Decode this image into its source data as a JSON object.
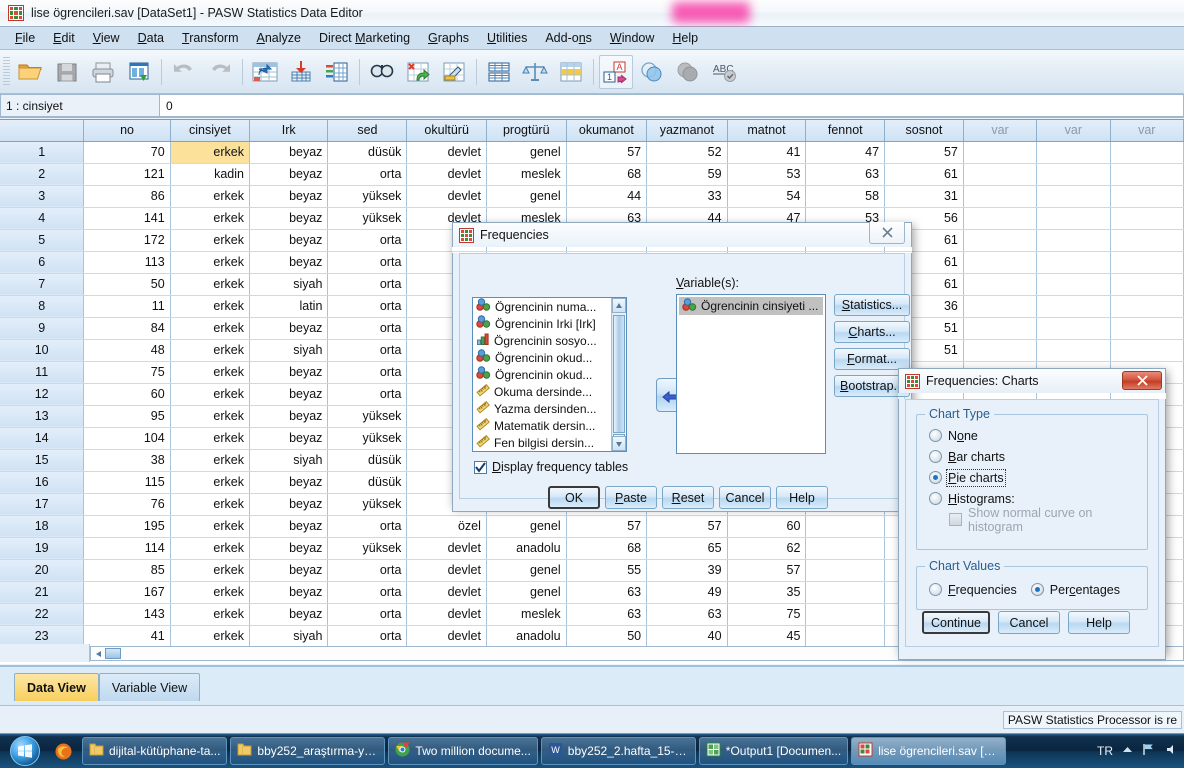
{
  "window": {
    "title": "lise ögrencileri.sav [DataSet1] - PASW Statistics Data Editor",
    "icon": "spss-data-editor-icon"
  },
  "menubar": [
    {
      "label": "File",
      "accel": "F"
    },
    {
      "label": "Edit",
      "accel": "E"
    },
    {
      "label": "View",
      "accel": "V"
    },
    {
      "label": "Data",
      "accel": "D"
    },
    {
      "label": "Transform",
      "accel": "T"
    },
    {
      "label": "Analyze",
      "accel": "A"
    },
    {
      "label": "Direct Marketing",
      "accel": "M"
    },
    {
      "label": "Graphs",
      "accel": "G"
    },
    {
      "label": "Utilities",
      "accel": "U"
    },
    {
      "label": "Add-ons",
      "accel": "n"
    },
    {
      "label": "Window",
      "accel": "W"
    },
    {
      "label": "Help",
      "accel": "H"
    }
  ],
  "toolbar": [
    "open-file-icon",
    "save-icon",
    "print-icon",
    "recall-dialogs-icon",
    "undo-icon",
    "redo-icon",
    "goto-case-icon",
    "goto-variable-icon",
    "variables-icon",
    "find-icon",
    "insert-case-icon",
    "insert-variable-icon",
    "split-file-icon",
    "weight-cases-icon",
    "select-cases-icon",
    "value-labels-icon",
    "use-variable-sets-icon",
    "show-all-variables-icon",
    "spell-check-icon"
  ],
  "cellref": {
    "name": "1 : cinsiyet",
    "value": "0"
  },
  "grid": {
    "columns": [
      "no",
      "cinsiyet",
      "Irk",
      "sed",
      "okultürü",
      "progtürü",
      "okumanot",
      "yazmanot",
      "matnot",
      "fennot",
      "sosnot",
      "var",
      "var",
      "var"
    ],
    "selected_cell": {
      "row": 1,
      "column": "cinsiyet"
    },
    "rows": [
      {
        "n": "1",
        "no": "70",
        "cinsiyet": "erkek",
        "Irk": "beyaz",
        "sed": "düsük",
        "okultürü": "devlet",
        "progtürü": "genel",
        "okumanot": "57",
        "yazmanot": "52",
        "matnot": "41",
        "fennot": "47",
        "sosnot": "57"
      },
      {
        "n": "2",
        "no": "121",
        "cinsiyet": "kadin",
        "Irk": "beyaz",
        "sed": "orta",
        "okultürü": "devlet",
        "progtürü": "meslek",
        "okumanot": "68",
        "yazmanot": "59",
        "matnot": "53",
        "fennot": "63",
        "sosnot": "61"
      },
      {
        "n": "3",
        "no": "86",
        "cinsiyet": "erkek",
        "Irk": "beyaz",
        "sed": "yüksek",
        "okultürü": "devlet",
        "progtürü": "genel",
        "okumanot": "44",
        "yazmanot": "33",
        "matnot": "54",
        "fennot": "58",
        "sosnot": "31"
      },
      {
        "n": "4",
        "no": "141",
        "cinsiyet": "erkek",
        "Irk": "beyaz",
        "sed": "yüksek",
        "okultürü": "devlet",
        "progtürü": "meslek",
        "okumanot": "63",
        "yazmanot": "44",
        "matnot": "47",
        "fennot": "53",
        "sosnot": "56"
      },
      {
        "n": "5",
        "no": "172",
        "cinsiyet": "erkek",
        "Irk": "beyaz",
        "sed": "orta",
        "okultürü": "",
        "progtürü": "",
        "okumanot": "",
        "yazmanot": "",
        "matnot": "",
        "fennot": "",
        "sosnot": "61"
      },
      {
        "n": "6",
        "no": "113",
        "cinsiyet": "erkek",
        "Irk": "beyaz",
        "sed": "orta",
        "okultürü": "",
        "progtürü": "",
        "okumanot": "",
        "yazmanot": "",
        "matnot": "",
        "fennot": "",
        "sosnot": "61"
      },
      {
        "n": "7",
        "no": "50",
        "cinsiyet": "erkek",
        "Irk": "siyah",
        "sed": "orta",
        "okultürü": "",
        "progtürü": "",
        "okumanot": "",
        "yazmanot": "",
        "matnot": "",
        "fennot": "",
        "sosnot": "61"
      },
      {
        "n": "8",
        "no": "11",
        "cinsiyet": "erkek",
        "Irk": "latin",
        "sed": "orta",
        "okultürü": "",
        "progtürü": "",
        "okumanot": "",
        "yazmanot": "",
        "matnot": "",
        "fennot": "",
        "sosnot": "36"
      },
      {
        "n": "9",
        "no": "84",
        "cinsiyet": "erkek",
        "Irk": "beyaz",
        "sed": "orta",
        "okultürü": "",
        "progtürü": "",
        "okumanot": "",
        "yazmanot": "",
        "matnot": "",
        "fennot": "",
        "sosnot": "51"
      },
      {
        "n": "10",
        "no": "48",
        "cinsiyet": "erkek",
        "Irk": "siyah",
        "sed": "orta",
        "okultürü": "",
        "progtürü": "",
        "okumanot": "",
        "yazmanot": "",
        "matnot": "",
        "fennot": "",
        "sosnot": "51"
      },
      {
        "n": "11",
        "no": "75",
        "cinsiyet": "erkek",
        "Irk": "beyaz",
        "sed": "orta",
        "okultürü": "",
        "progtürü": "",
        "okumanot": "",
        "yazmanot": "",
        "matnot": "",
        "fennot": "",
        "sosnot": ""
      },
      {
        "n": "12",
        "no": "60",
        "cinsiyet": "erkek",
        "Irk": "beyaz",
        "sed": "orta",
        "okultürü": "",
        "progtürü": "",
        "okumanot": "",
        "yazmanot": "",
        "matnot": "",
        "fennot": "",
        "sosnot": ""
      },
      {
        "n": "13",
        "no": "95",
        "cinsiyet": "erkek",
        "Irk": "beyaz",
        "sed": "yüksek",
        "okultürü": "",
        "progtürü": "",
        "okumanot": "",
        "yazmanot": "",
        "matnot": "",
        "fennot": "",
        "sosnot": ""
      },
      {
        "n": "14",
        "no": "104",
        "cinsiyet": "erkek",
        "Irk": "beyaz",
        "sed": "yüksek",
        "okultürü": "",
        "progtürü": "",
        "okumanot": "",
        "yazmanot": "",
        "matnot": "",
        "fennot": "",
        "sosnot": ""
      },
      {
        "n": "15",
        "no": "38",
        "cinsiyet": "erkek",
        "Irk": "siyah",
        "sed": "düsük",
        "okultürü": "",
        "progtürü": "",
        "okumanot": "",
        "yazmanot": "",
        "matnot": "",
        "fennot": "",
        "sosnot": ""
      },
      {
        "n": "16",
        "no": "115",
        "cinsiyet": "erkek",
        "Irk": "beyaz",
        "sed": "düsük",
        "okultürü": "",
        "progtürü": "",
        "okumanot": "",
        "yazmanot": "",
        "matnot": "",
        "fennot": "",
        "sosnot": ""
      },
      {
        "n": "17",
        "no": "76",
        "cinsiyet": "erkek",
        "Irk": "beyaz",
        "sed": "yüksek",
        "okultürü": "",
        "progtürü": "",
        "okumanot": "",
        "yazmanot": "",
        "matnot": "",
        "fennot": "",
        "sosnot": ""
      },
      {
        "n": "18",
        "no": "195",
        "cinsiyet": "erkek",
        "Irk": "beyaz",
        "sed": "orta",
        "okultürü": "özel",
        "progtürü": "genel",
        "okumanot": "57",
        "yazmanot": "57",
        "matnot": "60",
        "fennot": "",
        "sosnot": ""
      },
      {
        "n": "19",
        "no": "114",
        "cinsiyet": "erkek",
        "Irk": "beyaz",
        "sed": "yüksek",
        "okultürü": "devlet",
        "progtürü": "anadolu",
        "okumanot": "68",
        "yazmanot": "65",
        "matnot": "62",
        "fennot": "",
        "sosnot": ""
      },
      {
        "n": "20",
        "no": "85",
        "cinsiyet": "erkek",
        "Irk": "beyaz",
        "sed": "orta",
        "okultürü": "devlet",
        "progtürü": "genel",
        "okumanot": "55",
        "yazmanot": "39",
        "matnot": "57",
        "fennot": "",
        "sosnot": ""
      },
      {
        "n": "21",
        "no": "167",
        "cinsiyet": "erkek",
        "Irk": "beyaz",
        "sed": "orta",
        "okultürü": "devlet",
        "progtürü": "genel",
        "okumanot": "63",
        "yazmanot": "49",
        "matnot": "35",
        "fennot": "",
        "sosnot": ""
      },
      {
        "n": "22",
        "no": "143",
        "cinsiyet": "erkek",
        "Irk": "beyaz",
        "sed": "orta",
        "okultürü": "devlet",
        "progtürü": "meslek",
        "okumanot": "63",
        "yazmanot": "63",
        "matnot": "75",
        "fennot": "",
        "sosnot": ""
      },
      {
        "n": "23",
        "no": "41",
        "cinsiyet": "erkek",
        "Irk": "siyah",
        "sed": "orta",
        "okultürü": "devlet",
        "progtürü": "anadolu",
        "okumanot": "50",
        "yazmanot": "40",
        "matnot": "45",
        "fennot": "",
        "sosnot": ""
      }
    ]
  },
  "view_tabs": [
    {
      "label": "Data View",
      "active": true
    },
    {
      "label": "Variable View",
      "active": false
    }
  ],
  "statusbar": {
    "message": "PASW Statistics Processor is re"
  },
  "frequencies_dialog": {
    "title": "Frequencies",
    "close_label": "✖",
    "variables_label": "Variable(s):",
    "source_variables": [
      {
        "label": "Ögrencinin numa...",
        "icon": "nominal-icon"
      },
      {
        "label": "Ögrencinin Irki [Irk]",
        "icon": "nominal-icon"
      },
      {
        "label": "Ögrencinin sosyo...",
        "icon": "ordinal-icon"
      },
      {
        "label": "Ögrencinin okud...",
        "icon": "nominal-icon"
      },
      {
        "label": "Ögrencinin okud...",
        "icon": "nominal-icon"
      },
      {
        "label": "Okuma dersinde...",
        "icon": "scale-icon"
      },
      {
        "label": "Yazma dersinden...",
        "icon": "scale-icon"
      },
      {
        "label": "Matematik dersin...",
        "icon": "scale-icon"
      },
      {
        "label": "Fen bilgisi dersin...",
        "icon": "scale-icon"
      }
    ],
    "selected_variables": [
      {
        "label": "Ögrencinin cinsiyeti ...",
        "icon": "nominal-icon"
      }
    ],
    "side_buttons": [
      {
        "label": "Statistics...",
        "accel": "S"
      },
      {
        "label": "Charts...",
        "accel": "C"
      },
      {
        "label": "Format...",
        "accel": "F"
      },
      {
        "label": "Bootstrap...",
        "accel": "B"
      }
    ],
    "display_frequency_tables": {
      "label": "Display frequency tables",
      "checked": true
    },
    "buttons": [
      {
        "label": "OK",
        "default": true
      },
      {
        "label": "Paste",
        "default": false
      },
      {
        "label": "Reset",
        "default": false
      },
      {
        "label": "Cancel",
        "default": false
      },
      {
        "label": "Help",
        "default": false
      }
    ]
  },
  "charts_dialog": {
    "title": "Frequencies: Charts",
    "close_label": "✖",
    "chart_type": {
      "legend": "Chart Type",
      "options": [
        {
          "label": "None",
          "selected": false,
          "disabled": false
        },
        {
          "label": "Bar charts",
          "selected": false,
          "disabled": false
        },
        {
          "label": "Pie charts",
          "selected": true,
          "disabled": false
        },
        {
          "label": "Histograms:",
          "selected": false,
          "disabled": false
        }
      ],
      "normal_curve": {
        "label": "Show normal curve on histogram",
        "checked": false,
        "disabled": true
      }
    },
    "chart_values": {
      "legend": "Chart Values",
      "options": [
        {
          "label": "Frequencies",
          "selected": false
        },
        {
          "label": "Percentages",
          "selected": true
        }
      ]
    },
    "buttons": [
      {
        "label": "Continue",
        "default": true
      },
      {
        "label": "Cancel",
        "default": false
      },
      {
        "label": "Help",
        "default": false
      }
    ]
  },
  "taskbar": {
    "start_label": "start-orb",
    "quicklaunch": [
      {
        "icon": "firefox-icon"
      }
    ],
    "buttons": [
      {
        "label": "dijital-kütüphane-ta...",
        "icon": "folder-icon",
        "active": false
      },
      {
        "label": "bby252_araştırma-yö...",
        "icon": "folder-icon",
        "active": false
      },
      {
        "label": "Two million docume...",
        "icon": "chrome-icon",
        "active": false
      },
      {
        "label": "bby252_2.hafta_15-3...",
        "icon": "word-icon",
        "active": false
      },
      {
        "label": "*Output1 [Documen...",
        "icon": "spss-viewer-icon",
        "active": false
      },
      {
        "label": "lise ögrencileri.sav [D...",
        "icon": "spss-data-editor-icon",
        "active": true
      }
    ],
    "tray": {
      "language": "TR",
      "show_hidden": "show-hidden-icons-icon",
      "network": "network-icon",
      "volume": "volume-icon"
    }
  }
}
